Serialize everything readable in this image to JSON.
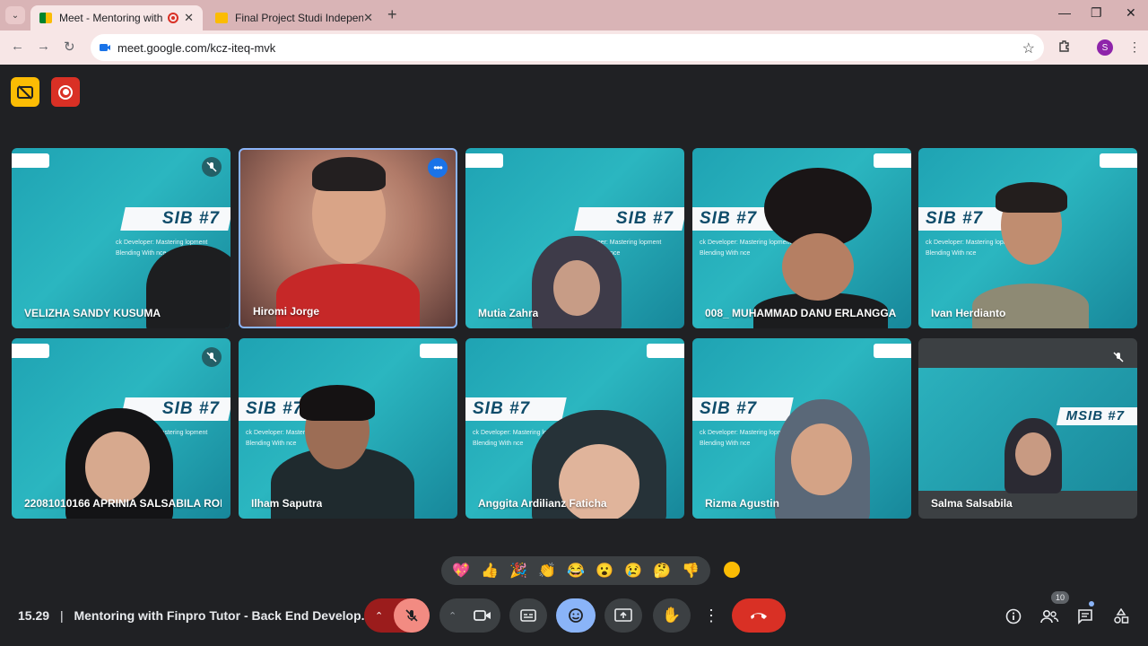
{
  "browser": {
    "tabs": [
      {
        "title": "Meet - Mentoring with Finpro",
        "active": true,
        "recording": true
      },
      {
        "title": "Final Project Studi Independen",
        "active": false
      }
    ],
    "url": "meet.google.com/kcz-iteq-mvk",
    "profile_initial": "S",
    "colors": {
      "tabstrip": "#d9b4b6",
      "toolbar": "#f7e6e6"
    }
  },
  "meeting": {
    "time": "15.29",
    "title": "Mentoring with Finpro Tutor - Back End Develop...",
    "participant_count": "10",
    "banner_text": "SIB #7",
    "banner_text_salma": "MSIB #7",
    "subtext": "ck Developer: Mastering lopment Blending With nce",
    "participants": [
      {
        "name": "VELIZHA SANDY KUSUMA",
        "muted": true
      },
      {
        "name": "Hiromi Jorge",
        "muted": false,
        "speaking": true
      },
      {
        "name": "Mutia Zahra",
        "muted": false
      },
      {
        "name": "008_ MUHAMMAD DANU ERLANGGA",
        "muted": false
      },
      {
        "name": "Ivan Herdianto",
        "muted": false
      },
      {
        "name": "22081010166 APRINIA SALSABILA ROI...",
        "muted": true
      },
      {
        "name": "Ilham Saputra",
        "muted": false
      },
      {
        "name": "Anggita Ardilianz Faticha",
        "muted": false
      },
      {
        "name": "Rizma Agustin",
        "muted": false
      },
      {
        "name": "Salma Salsabila",
        "muted": true
      }
    ],
    "reactions": [
      "💖",
      "👍",
      "🎉",
      "👏",
      "😂",
      "😮",
      "😢",
      "🤔",
      "👎"
    ],
    "icons": {
      "captions": "captions-off-icon",
      "recording": "recording-icon",
      "mic": "mic-off-icon",
      "camera": "camera-icon",
      "cc": "closed-captions-icon",
      "emoji": "emoji-icon",
      "present": "present-screen-icon",
      "hand": "raise-hand-icon",
      "more": "more-options-icon",
      "leave": "leave-call-icon",
      "info": "meeting-info-icon",
      "people": "people-icon",
      "chat": "chat-icon",
      "activities": "activities-icon"
    }
  }
}
